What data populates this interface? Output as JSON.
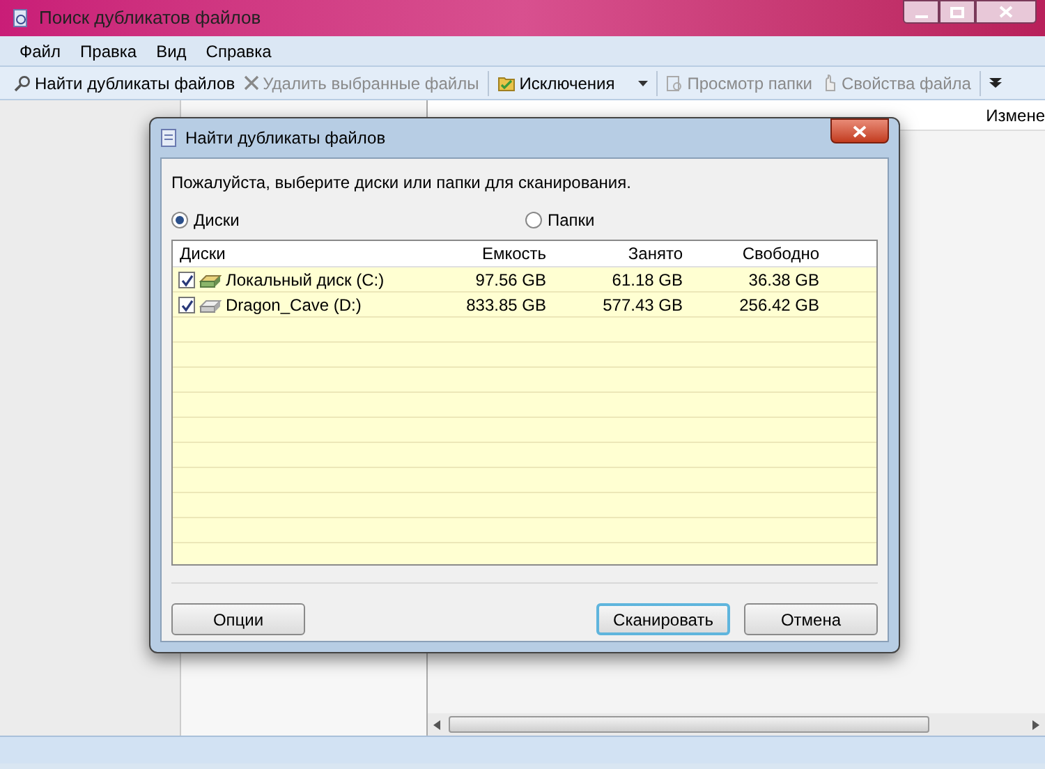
{
  "window": {
    "title": "Поиск дубликатов файлов"
  },
  "menu": [
    "Файл",
    "Правка",
    "Вид",
    "Справка"
  ],
  "toolbar": [
    {
      "kind": "search",
      "label": "Найти дубликаты файлов",
      "disabled": false
    },
    {
      "kind": "delete",
      "label": "Удалить выбранные файлы",
      "disabled": true
    },
    {
      "kind": "exclude",
      "label": "Исключения",
      "disabled": false,
      "dropdown": true
    },
    {
      "kind": "view",
      "label": "Просмотр папки",
      "disabled": true
    },
    {
      "kind": "props",
      "label": "Свойства файла",
      "disabled": true
    }
  ],
  "results": {
    "columns": [
      "Измене"
    ]
  },
  "dialog": {
    "title": "Найти дубликаты файлов",
    "prompt": "Пожалуйста, выберите диски или папки для сканирования.",
    "radios": [
      {
        "label": "Диски",
        "selected": true
      },
      {
        "label": "Папки",
        "selected": false
      }
    ],
    "table": {
      "columns": [
        "Диски",
        "Емкость",
        "Занято",
        "Свободно"
      ],
      "rows": [
        {
          "kind": "local",
          "name": "Локальный диск (C:)",
          "checked": true,
          "capacity": "97.56 GB",
          "used": "61.18 GB",
          "free": "36.38 GB"
        },
        {
          "kind": "drive",
          "name": "Dragon_Cave (D:)",
          "checked": true,
          "capacity": "833.85 GB",
          "used": "577.43 GB",
          "free": "256.42 GB"
        }
      ]
    },
    "buttons": [
      {
        "label": "Опции",
        "default": false
      },
      {
        "label": "Сканировать",
        "default": true
      },
      {
        "label": "Отмена",
        "default": false
      }
    ]
  }
}
